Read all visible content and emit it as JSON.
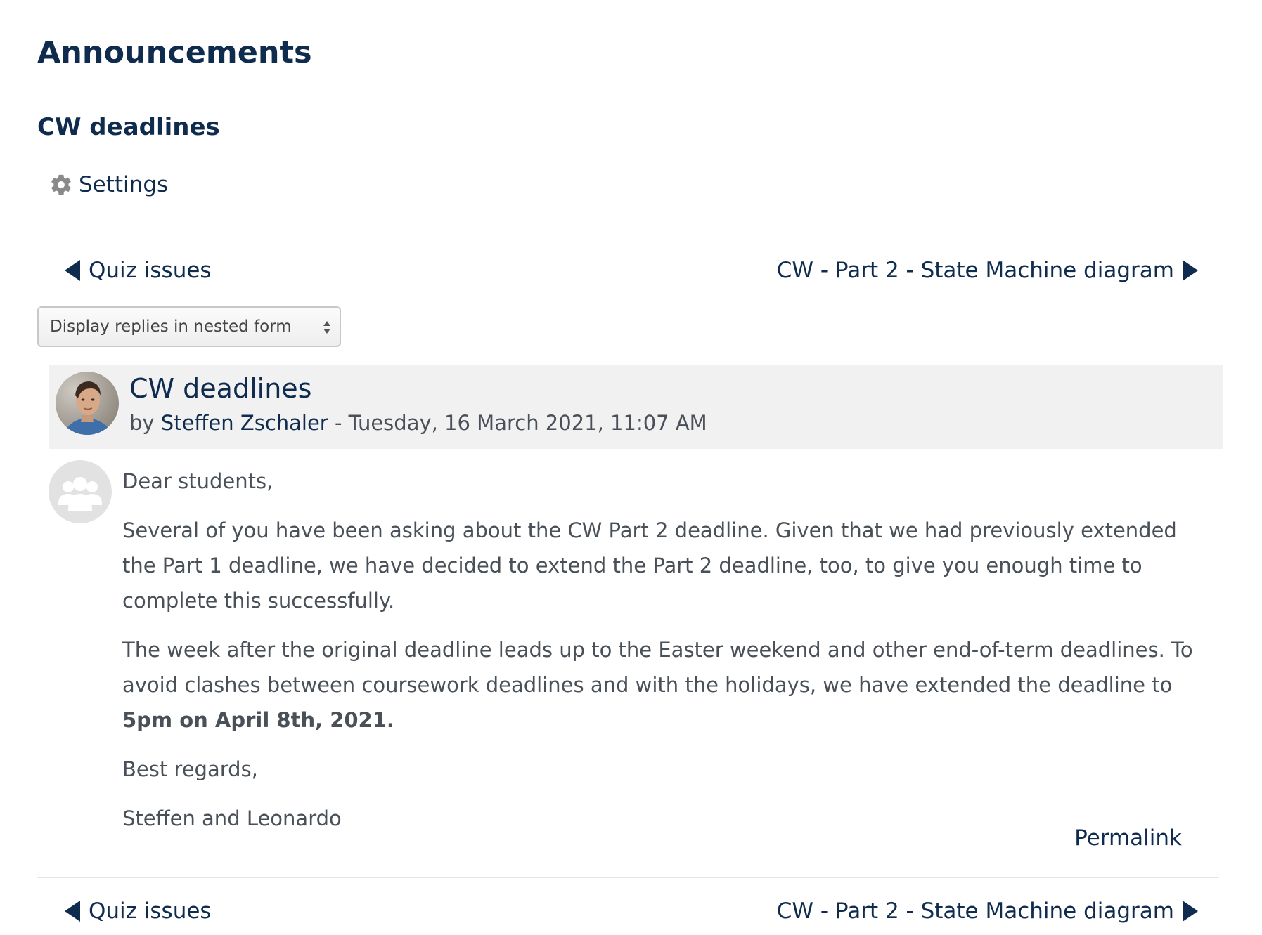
{
  "page": {
    "title": "Announcements"
  },
  "discussion": {
    "title": "CW deadlines"
  },
  "settings": {
    "label": "Settings"
  },
  "navigation": {
    "previous_label": "Quiz issues",
    "next_label": "CW - Part 2 - State Machine diagram"
  },
  "display_mode": {
    "selected": "Display replies in nested form"
  },
  "post": {
    "subject": "CW deadlines",
    "by_prefix": "by",
    "author": "Steffen Zschaler",
    "date_separator": " - ",
    "date": "Tuesday, 16 March 2021, 11:07 AM",
    "greeting": "Dear students,",
    "paragraph1": "Several of you have been asking about the CW Part 2 deadline. Given that we had previously extended the Part 1 deadline, we have decided to extend the Part 2 deadline, too, to give you enough time to complete this successfully.",
    "paragraph2_text": "The week after the original deadline leads up to the Easter weekend and other end-of-term deadlines. To avoid clashes between coursework deadlines and with the holidays, we have extended the deadline to",
    "paragraph2_bold": "5pm on April 8th, 2021.",
    "closing": "Best regards,",
    "signature": "Steffen and Leonardo",
    "permalink_label": "Permalink"
  },
  "colors": {
    "heading": "#0f2c4f",
    "body_text": "#495057",
    "post_header_bg": "#f1f1f1"
  },
  "icons": {
    "settings": "gear-icon",
    "previous": "caret-left-icon",
    "next": "caret-right-icon",
    "author_avatar": "user-avatar",
    "group": "group-icon"
  }
}
